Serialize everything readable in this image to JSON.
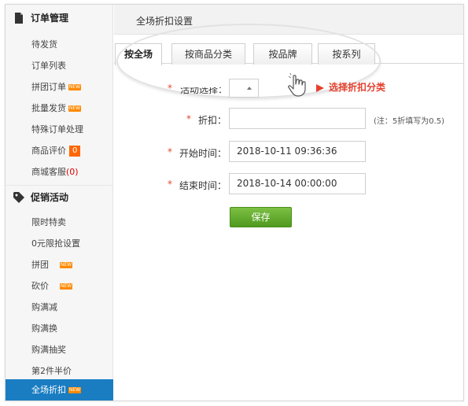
{
  "sidebar": {
    "groups": [
      {
        "title": "订单管理",
        "icon": "document-icon",
        "items": [
          {
            "label": "待发货"
          },
          {
            "label": "订单列表"
          },
          {
            "label": "拼团订单",
            "badge": "NEW"
          },
          {
            "label": "批量发货",
            "badge": "NEW"
          },
          {
            "label": "特殊订单处理"
          },
          {
            "label": "商品评价",
            "count": "0"
          },
          {
            "label": "商城客服",
            "count_paren": "(0)"
          }
        ]
      },
      {
        "title": "促销活动",
        "icon": "tag-icon",
        "items": [
          {
            "label": "限时特卖"
          },
          {
            "label": "0元限抢设置"
          },
          {
            "label": "拼团",
            "badge": "NEW"
          },
          {
            "label": "砍价",
            "badge": "NEW"
          },
          {
            "label": "购满减"
          },
          {
            "label": "购满换"
          },
          {
            "label": "购满抽奖"
          },
          {
            "label": "第2件半价"
          },
          {
            "label": "全场折扣",
            "badge": "NEW",
            "active": true
          }
        ]
      }
    ]
  },
  "header": {
    "title": "全场折扣设置"
  },
  "tabs": [
    {
      "label": "按全场",
      "active": true
    },
    {
      "label": "按商品分类"
    },
    {
      "label": "按品牌"
    },
    {
      "label": "按系列"
    }
  ],
  "hint": {
    "text": "选择折扣分类"
  },
  "form": {
    "scope_label": "活动选择：",
    "discount": {
      "star": "*",
      "label": "折扣：",
      "value": "",
      "note": "(注：5折填写为0.5)"
    },
    "start_time": {
      "star": "*",
      "label": "开始时间：",
      "value": "2018-10-11 09:36:36"
    },
    "end_time": {
      "star": "*",
      "label": "结束时间：",
      "value": "2018-10-14 00:00:00"
    },
    "scope_star": "*",
    "save_label": "保存"
  },
  "colors": {
    "accent": "#1a7dc2",
    "badge": "#ff8a00",
    "required_star": "#e04a2d",
    "hint": "#e4402d",
    "save_button": "#5ea72a"
  }
}
